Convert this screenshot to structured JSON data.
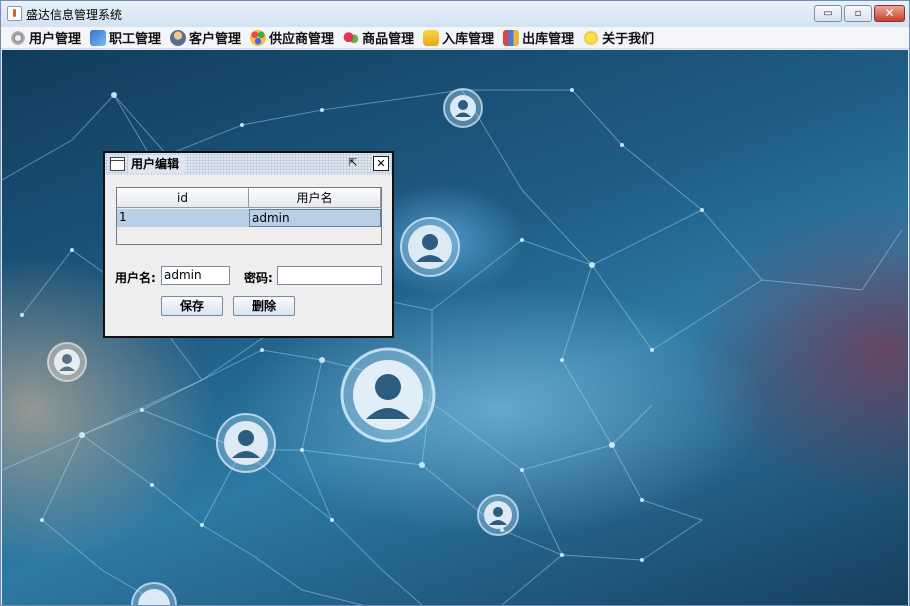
{
  "window": {
    "title": "盛达信息管理系统",
    "buttons": {
      "minimize": "▭",
      "maximize": "▫",
      "close": "✕"
    }
  },
  "menu": {
    "items": [
      {
        "label": "用户管理",
        "icon": "gear-icon"
      },
      {
        "label": "职工管理",
        "icon": "staff-icon"
      },
      {
        "label": "客户管理",
        "icon": "customer-icon"
      },
      {
        "label": "供应商管理",
        "icon": "supplier-icon"
      },
      {
        "label": "商品管理",
        "icon": "goods-icon"
      },
      {
        "label": "入库管理",
        "icon": "stock-in-icon"
      },
      {
        "label": "出库管理",
        "icon": "stock-out-icon"
      },
      {
        "label": "关于我们",
        "icon": "star-icon"
      }
    ]
  },
  "dialog": {
    "title": "用户编辑",
    "table": {
      "columns": [
        "id",
        "用户名"
      ],
      "rows": [
        [
          "1",
          "admin"
        ]
      ]
    },
    "form": {
      "username_label": "用户名:",
      "username_value": "admin",
      "password_label": "密码:",
      "password_value": ""
    },
    "buttons": {
      "save": "保存",
      "delete": "删除"
    }
  }
}
